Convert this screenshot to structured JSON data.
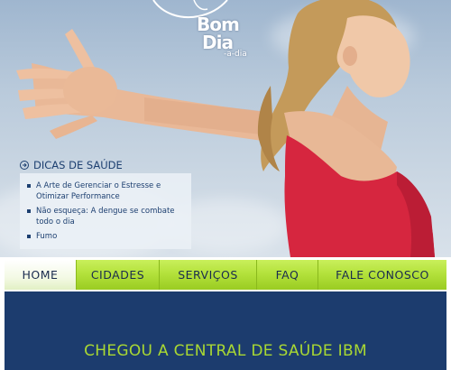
{
  "logo": {
    "line1": "Bom",
    "line2": "Dia",
    "line3": "-a-dia"
  },
  "health_tips": {
    "title": "DICAS DE SAÚDE",
    "items": [
      "A Arte de Gerenciar o Estresse e Otimizar Performance",
      "Não esqueça: A dengue se combate todo o dia",
      "Fumo"
    ]
  },
  "nav": {
    "items": [
      "HOME",
      "CIDADES",
      "SERVIÇOS",
      "FAQ",
      "FALE CONOSCO"
    ],
    "active": "HOME"
  },
  "banner": {
    "headline": "CHEGOU A CENTRAL DE SAÚDE IBM"
  },
  "colors": {
    "navy": "#1c3c6e",
    "lime": "#a9d833",
    "nav_green": "#b4e23c"
  }
}
